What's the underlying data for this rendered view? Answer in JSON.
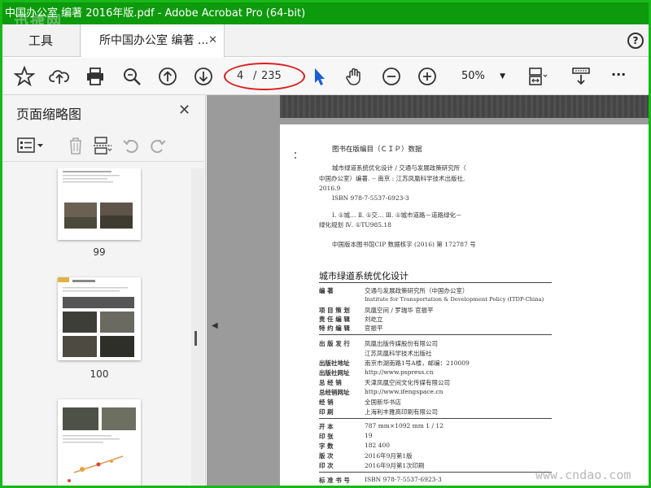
{
  "window": {
    "title": "中国办公室 编著 2016年版.pdf - Adobe Acrobat Pro (64-bit)",
    "watermark": "迅捷网"
  },
  "tabs": {
    "tools_label": "工具",
    "doc_label": "所中国办公室 编著 ...",
    "close_glyph": "✕",
    "help_glyph": "?"
  },
  "toolbar": {
    "page_current": "4",
    "page_sep": "/",
    "page_total": "235",
    "zoom": "50%",
    "more": "···"
  },
  "panel": {
    "title": "页面缩略图",
    "close_glyph": "✕",
    "thumbnails": [
      {
        "label": "99"
      },
      {
        "label": "100"
      },
      {
        "label": ""
      }
    ]
  },
  "document": {
    "cip_title": "图书在版编目（ＣＩＰ）数据",
    "cip_lines": [
      "城市绿道系统优化设计 / 交通与发展政策研究所（",
      "中国办公室）编著. -- 南京 : 江苏凤凰科学技术出版社,",
      "2016.9",
      "ISBN 978-7-5537-6923-3",
      "Ⅰ. ①城… Ⅱ. ①交… Ⅲ. ①城市道路－道路绿化－",
      "绿化规划 Ⅳ. ①TU985.18",
      "中国版本图书馆CIP 数据核字 (2016) 第 172787 号"
    ],
    "book_title": "城市绿道系统优化设计",
    "credits": [
      {
        "label": "编          著",
        "value": "交通与发展政策研究所（中国办公室）"
      },
      {
        "label": "",
        "value": "Institute for Transportation & Development Policy (ITDP-China)"
      },
      {
        "label": "项 目 策 划",
        "value": "凤凰空间 / 罗瑞华  官振平"
      },
      {
        "label": "责 任 编 辑",
        "value": "刘屹立"
      },
      {
        "label": "特 约 编 辑",
        "value": "官振平"
      }
    ],
    "publisher": [
      {
        "label": "出 版 发 行",
        "value": "凤凰出版传媒股份有限公司"
      },
      {
        "label": "",
        "value": "江苏凤凰科学技术出版社"
      },
      {
        "label": "出版社地址",
        "value": "南京市湖南路1号A楼，邮编：210009"
      },
      {
        "label": "出版社网址",
        "value": "http://www.pspress.cn"
      },
      {
        "label": "总    经    销",
        "value": "天津凤凰空间文化传媒有限公司"
      },
      {
        "label": "总经销网址",
        "value": "http://www.ifengspace.cn"
      },
      {
        "label": "经          销",
        "value": "全国新华书店"
      },
      {
        "label": "印          刷",
        "value": "上海利丰雅高印刷有限公司"
      }
    ],
    "specs": [
      {
        "label": "开          本",
        "value": "787 mm×1092 mm  1 / 12"
      },
      {
        "label": "印          张",
        "value": "19"
      },
      {
        "label": "字          数",
        "value": "182 400"
      },
      {
        "label": "版          次",
        "value": "2016年9月第1版"
      },
      {
        "label": "印          次",
        "value": "2016年9月第1次印刷"
      }
    ],
    "isbn_row": {
      "label": "标 准 书 号",
      "value": "ISBN 978-7-5537-6923-3"
    }
  },
  "watermark_br": "www.cndao.com"
}
